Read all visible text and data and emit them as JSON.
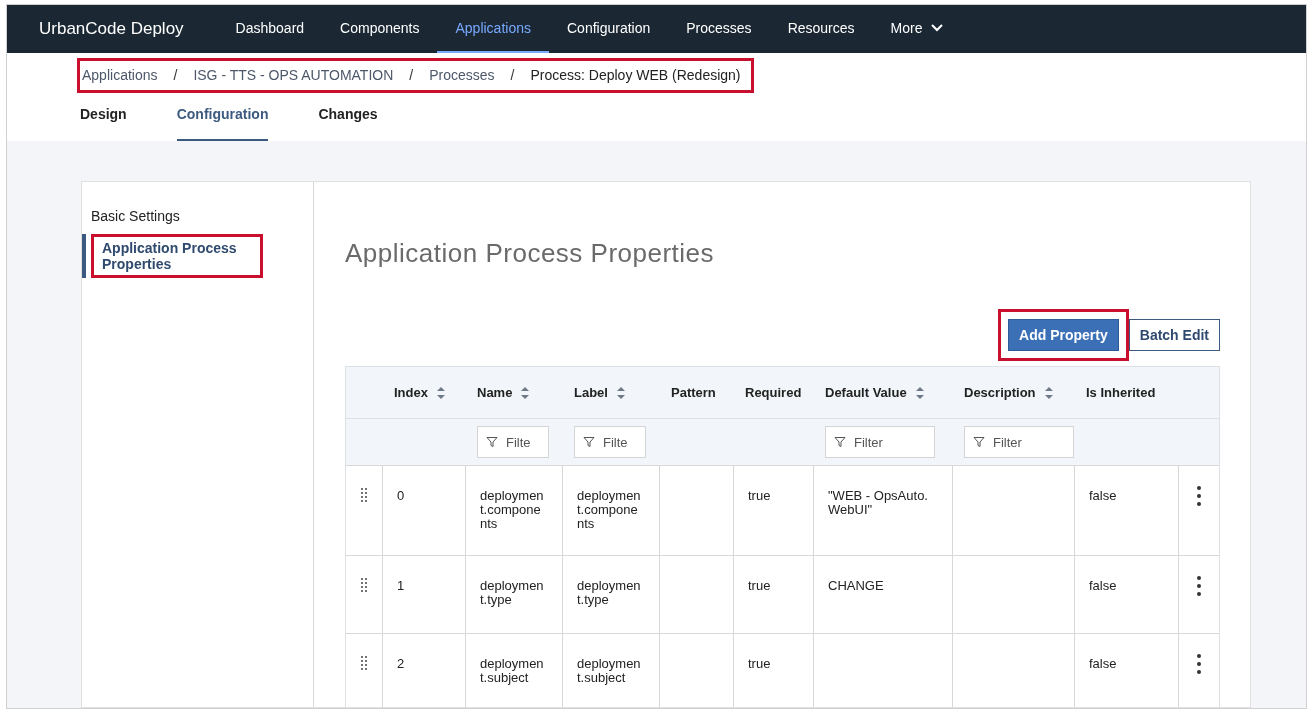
{
  "nav": {
    "brand": "UrbanCode Deploy",
    "items": [
      {
        "label": "Dashboard",
        "selected": false,
        "kind": "link"
      },
      {
        "label": "Components",
        "selected": false,
        "kind": "link"
      },
      {
        "label": "Applications",
        "selected": true,
        "kind": "link"
      },
      {
        "label": "Configuration",
        "selected": false,
        "kind": "link"
      },
      {
        "label": "Processes",
        "selected": false,
        "kind": "link"
      },
      {
        "label": "Resources",
        "selected": false,
        "kind": "link"
      },
      {
        "label": "More",
        "selected": false,
        "kind": "menu"
      }
    ]
  },
  "breadcrumb": {
    "highlighted": true,
    "items": [
      {
        "label": "Applications",
        "kind": "link"
      },
      {
        "label": "/",
        "kind": "separator"
      },
      {
        "label": "ISG - TTS - OPS AUTOMATION",
        "kind": "link"
      },
      {
        "label": "/",
        "kind": "separator"
      },
      {
        "label": "Processes",
        "kind": "link"
      },
      {
        "label": "/",
        "kind": "separator"
      },
      {
        "label": "Process: Deploy WEB (Redesign)",
        "kind": "current"
      }
    ]
  },
  "tabs": [
    {
      "label": "Design",
      "selected": false
    },
    {
      "label": "Configuration",
      "selected": true
    },
    {
      "label": "Changes",
      "selected": false
    }
  ],
  "sidebar": {
    "items": [
      {
        "label": "Basic Settings",
        "selected": false,
        "highlighted": false
      },
      {
        "label": "Application Process Properties",
        "selected": true,
        "highlighted": true
      }
    ]
  },
  "heading": "Application Process Properties",
  "buttons": [
    {
      "label": "Add Property",
      "kind": "primary",
      "highlighted": true
    },
    {
      "label": "Batch Edit",
      "kind": "secondary",
      "highlighted": false
    }
  ],
  "table": {
    "columns": [
      {
        "label": "Index",
        "sortable": true
      },
      {
        "label": "Name",
        "sortable": true,
        "filter_placeholder": "Filte"
      },
      {
        "label": "Label",
        "sortable": true,
        "filter_placeholder": "Filte"
      },
      {
        "label": "Pattern",
        "sortable": false
      },
      {
        "label": "Required",
        "sortable": false
      },
      {
        "label": "Default Value",
        "sortable": true,
        "filter_placeholder": "Filter"
      },
      {
        "label": "Description",
        "sortable": true,
        "filter_placeholder": "Filter"
      },
      {
        "label": "Is Inherited",
        "sortable": false
      }
    ],
    "rows": [
      {
        "cells": [
          "0",
          "deployment.components",
          "deployment.components",
          "",
          "true",
          "\"WEB - OpsAuto.WebUI\"",
          "",
          "false"
        ]
      },
      {
        "cells": [
          "1",
          "deployment.type",
          "deployment.type",
          "",
          "true",
          "CHANGE",
          "",
          "false"
        ]
      },
      {
        "cells": [
          "2",
          "deployment.subject",
          "deployment.subject",
          "",
          "true",
          "",
          "",
          "false"
        ]
      }
    ]
  }
}
